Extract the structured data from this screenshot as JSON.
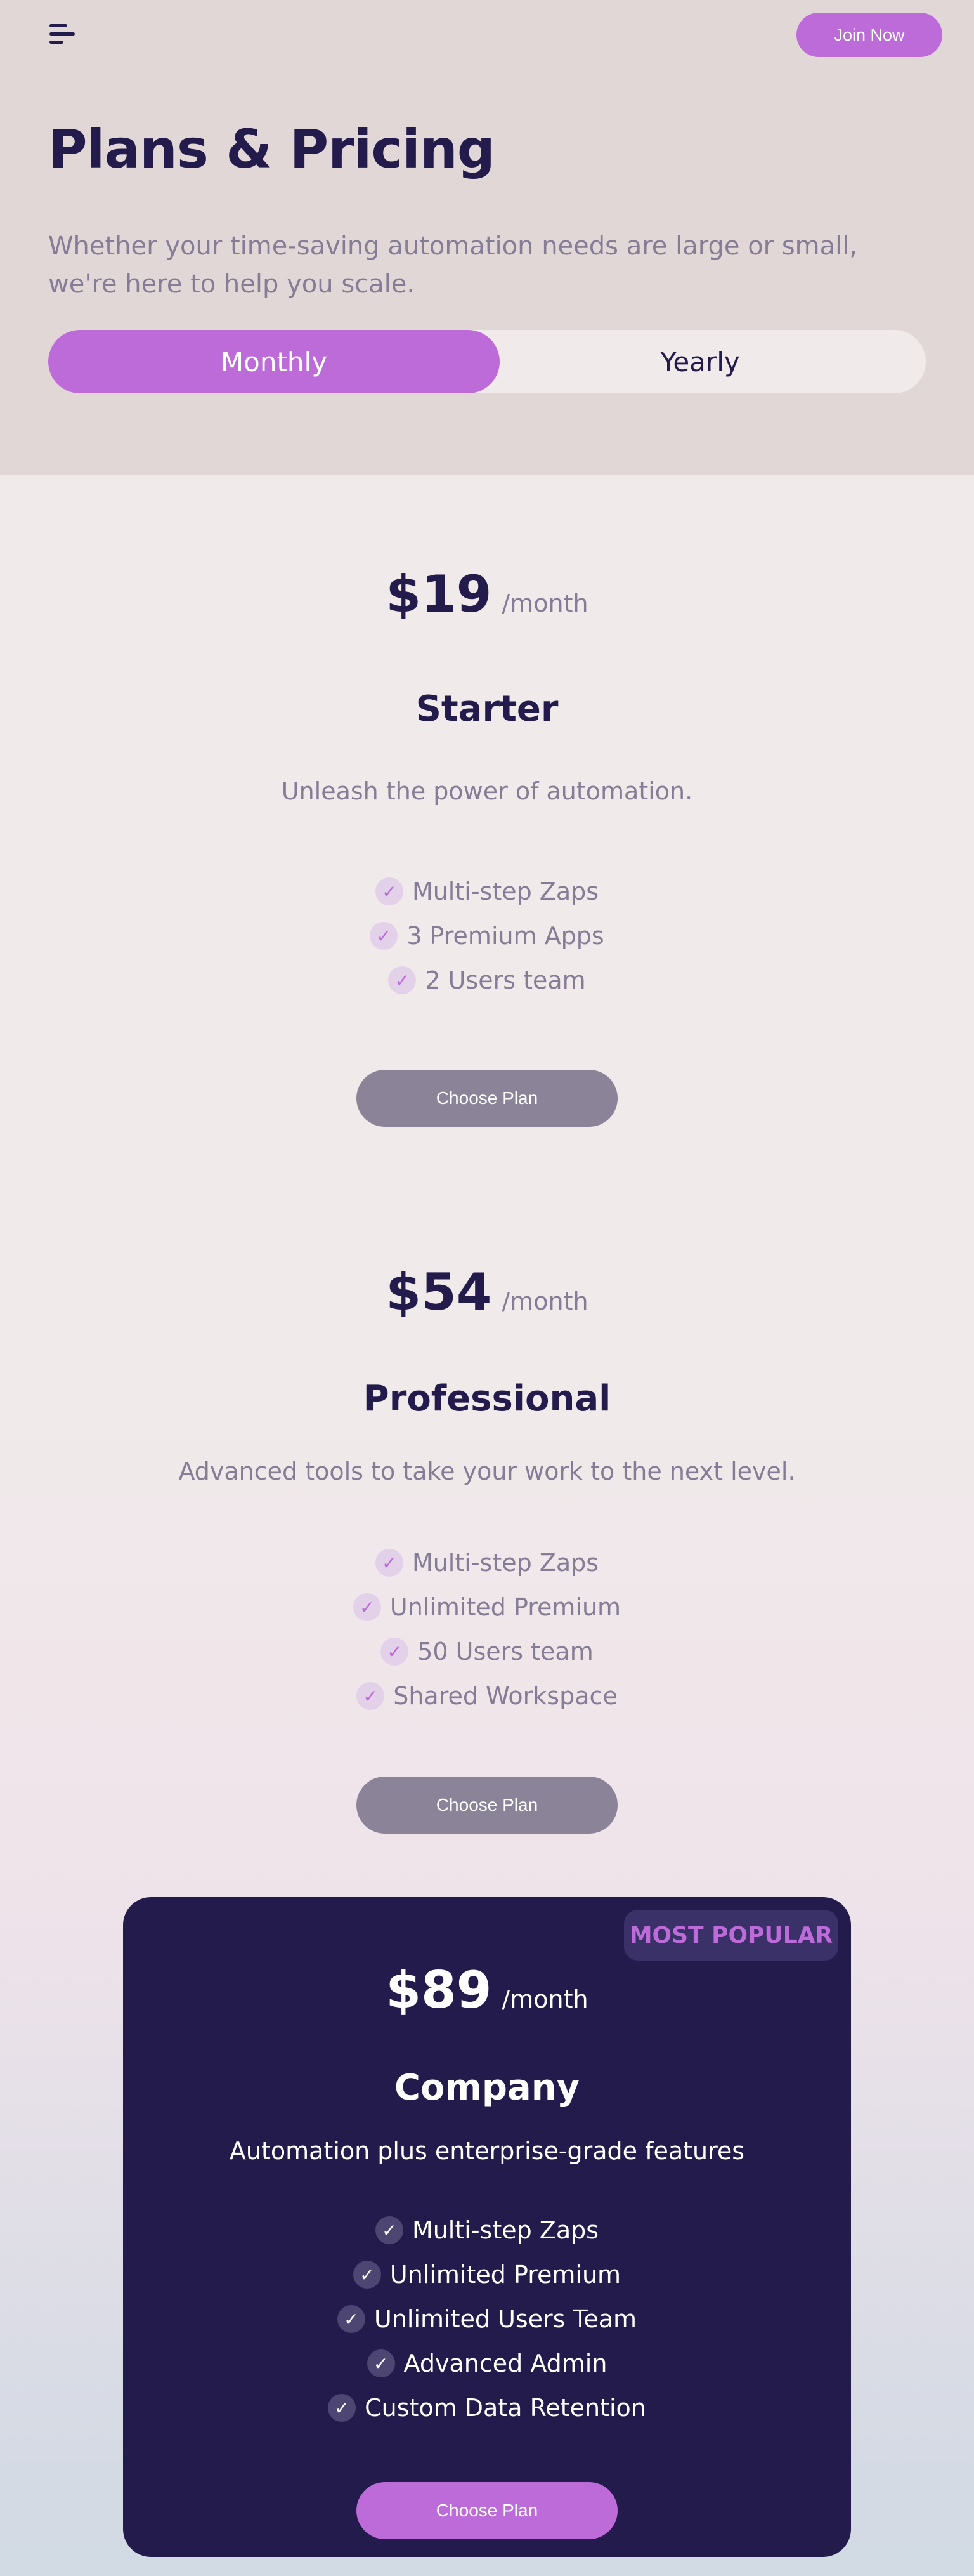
{
  "header": {
    "menu_icon": "hamburger-menu-icon",
    "join_label": "Join Now"
  },
  "hero": {
    "title": "Plans & Pricing",
    "subtitle": "Whether your time-saving automation needs are large or small, we're here to help you scale."
  },
  "billing_toggle": {
    "monthly_label": "Monthly",
    "yearly_label": "Yearly",
    "selected": "Monthly"
  },
  "plans": [
    {
      "price": "$19",
      "period": "/month",
      "name": "Starter",
      "description": "Unleash the power of automation.",
      "features": [
        "Multi-step Zaps",
        "3 Premium Apps",
        "2 Users team"
      ],
      "button_label": "Choose Plan"
    },
    {
      "price": "$54",
      "period": "/month",
      "name": "Professional",
      "description": "Advanced tools to take your work to the next level.",
      "features": [
        "Multi-step Zaps",
        "Unlimited Premium",
        "50 Users team",
        "Shared Workspace"
      ],
      "button_label": "Choose Plan"
    },
    {
      "price": "$89",
      "period": "/month",
      "name": "Company",
      "badge": "MOST POPULAR",
      "description": "Automation plus enterprise-grade features",
      "features": [
        "Multi-step Zaps",
        "Unlimited Premium",
        "Unlimited Users Team",
        "Advanced Admin",
        "Custom Data Retention"
      ],
      "button_label": "Choose Plan"
    }
  ],
  "icons": {
    "check": "check-icon",
    "check_glyph": "✓"
  },
  "colors": {
    "accent": "#bd6bd9",
    "dark_navy": "#231b4b",
    "muted_text": "#857c96",
    "hero_bg": "#e2d7d7",
    "page_bg": "#f0eaea",
    "button_grey": "#8b8499"
  }
}
